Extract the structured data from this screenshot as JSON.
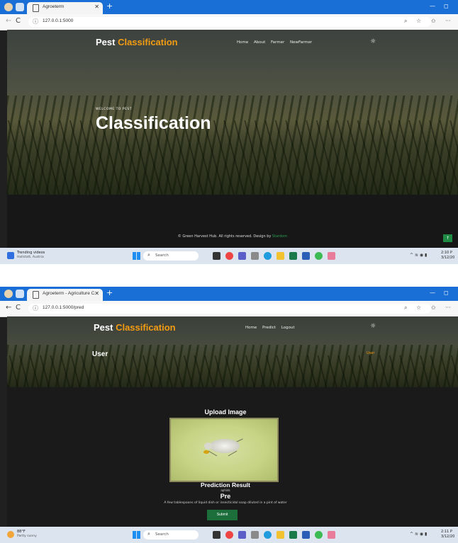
{
  "shot1": {
    "tab_title": "Agroeterm",
    "url": "127.0.0.1:5000",
    "logo": {
      "part1": "Pest ",
      "part2": "Classification"
    },
    "nav": [
      "Home",
      "About",
      "Farmer",
      "NewFarmer"
    ],
    "hero": {
      "kicker": "WELCOME TO PEST",
      "headline": "Classification"
    },
    "footer": {
      "copyright": "© Green Harvest Hub. All rights reserved. Design by ",
      "designer": "Stardom"
    },
    "up_button": "↑",
    "taskbar": {
      "widget_title": "Trending videos",
      "widget_sub": "Hallstatt, Austria",
      "search": "Search",
      "time": "2:10 P",
      "date": "3/12/20"
    }
  },
  "shot2": {
    "tab_title": "Agroeterm - Agriculture Categor",
    "url": "127.0.0.1:5000/pred",
    "logo": {
      "part1": "Pest ",
      "part2": "Classification"
    },
    "nav": [
      "Home",
      "Predict",
      "Logout"
    ],
    "page_label": "User",
    "page_label_right": "User",
    "upload_title": "Upload Image",
    "prediction": {
      "title": "Prediction Result",
      "class_name": "aphids",
      "label": "Pre",
      "remedy": "A few tablespoons of liquid dish or insecticidal soap diluted in a pint of water"
    },
    "submit": "Submit",
    "taskbar": {
      "weather": "88°F",
      "weather_sub": "Partly sunny",
      "search": "Search",
      "time": "2:11 P",
      "date": "3/12/20"
    }
  },
  "colors": {
    "accent": "#f39c12",
    "green": "#1c6e3a",
    "browser_blue": "#1a6fd6"
  },
  "icons": [
    "back-arrow-icon",
    "refresh-icon",
    "info-icon",
    "sun-icon",
    "search-icon",
    "windows-icon",
    "close-icon",
    "plus-icon"
  ]
}
